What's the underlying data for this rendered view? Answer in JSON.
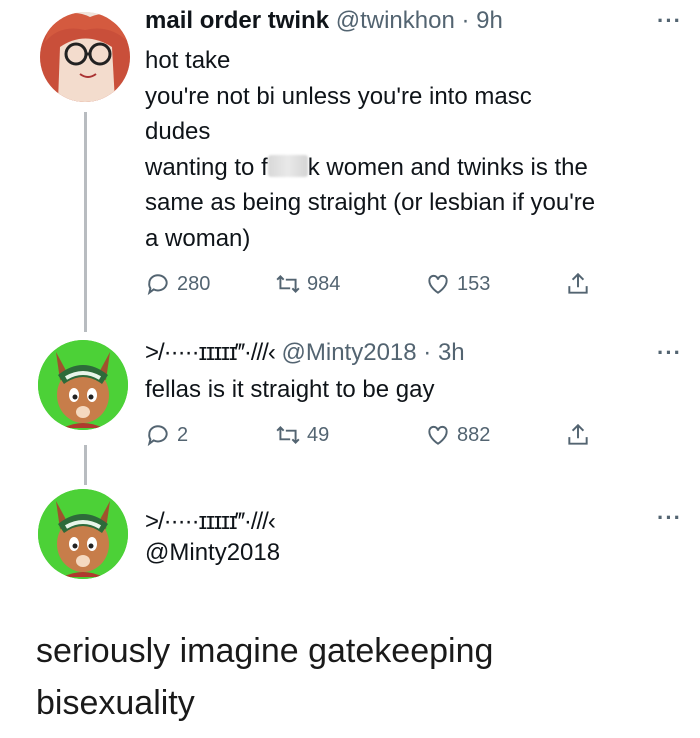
{
  "tweet1": {
    "name": "mail order twink",
    "handle": "@twinkhon",
    "dot": "·",
    "time": "9h",
    "line1": "hot take",
    "line2": "you're not bi unless you're into masc",
    "line3": "dudes",
    "line4a": "wanting to f",
    "line4b": "k women and twinks is the",
    "line5": "same as being straight (or lesbian if you're",
    "line6": "a woman)",
    "replies": "280",
    "retweets": "984",
    "likes": "153"
  },
  "tweet2": {
    "name": ">/·····ɪɪɪɪɪ‴·///‹",
    "handle": "@Minty2018",
    "dot": "·",
    "time": "3h",
    "text": "fellas is it straight to be gay",
    "replies": "2",
    "retweets": "49",
    "likes": "882"
  },
  "tweet3": {
    "name": ">/·····ɪɪɪɪɪ‴·///‹",
    "handle": "@Minty2018"
  },
  "more_label": "···",
  "caption": {
    "line1": "seriously imagine gatekeeping",
    "line2": "bisexuality"
  },
  "colors": {
    "avatar1_bg": "#e9d3c8",
    "avatar2_bg": "#4cd137",
    "text_secondary": "#536471",
    "thread_line": "#b8bcc0"
  },
  "icons": [
    "reply-icon",
    "retweet-icon",
    "like-icon",
    "share-icon",
    "more-icon"
  ]
}
